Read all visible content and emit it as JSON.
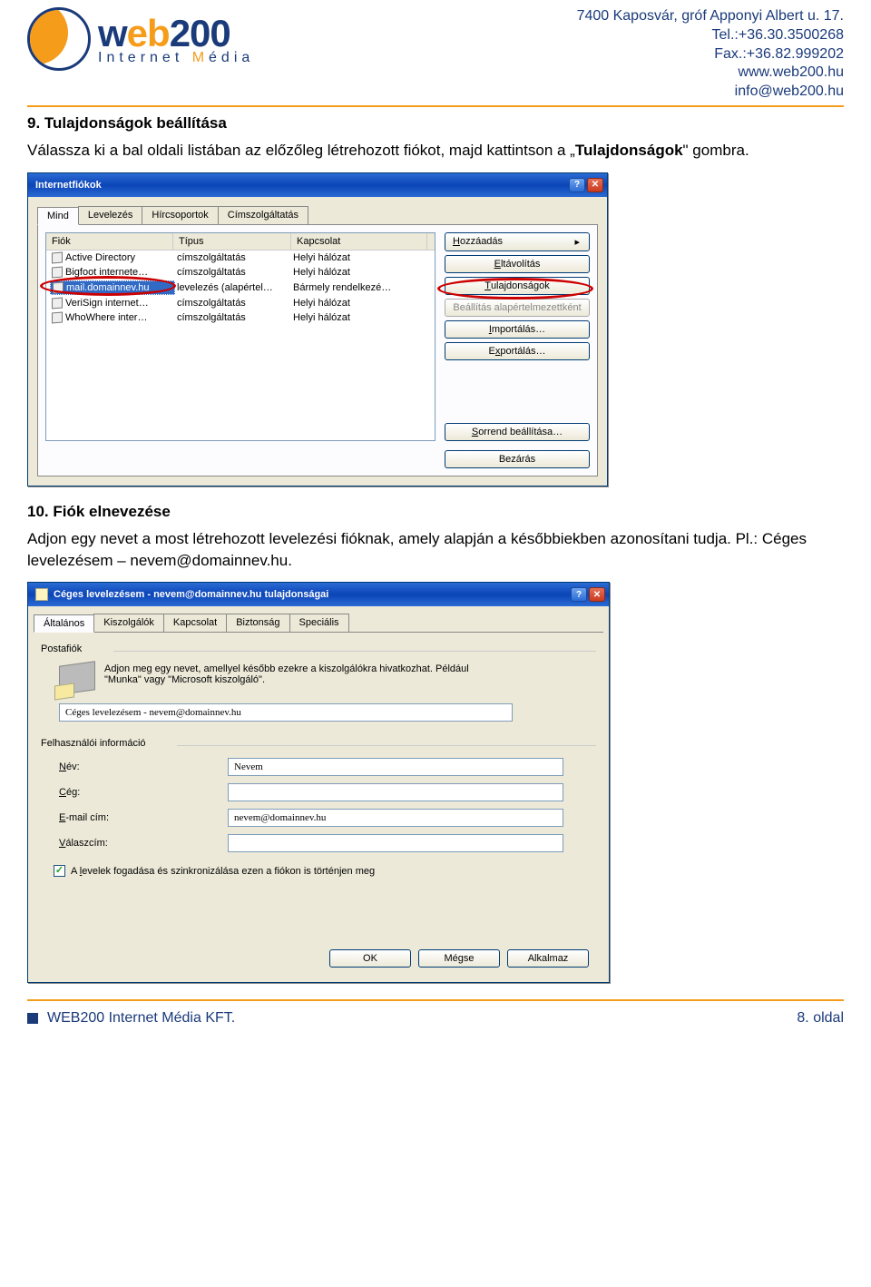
{
  "header": {
    "company_name": "web200",
    "subtitle": "Internet Média",
    "contact": {
      "address": "7400 Kaposvár, gróf Apponyi Albert u. 17.",
      "tel": "Tel.:+36.30.3500268",
      "fax": "Fax.:+36.82.999202",
      "web": "www.web200.hu",
      "email": "info@web200.hu"
    }
  },
  "section9": {
    "heading": "9.   Tulajdonságok beállítása",
    "text_pre": "Válassza ki a bal oldali listában az előzőleg létrehozott fiókot, majd kattintson a „",
    "text_bold": "Tulajdonságok",
    "text_post": "\" gombra."
  },
  "dialog1": {
    "title": "Internetfiókok",
    "tabs": [
      "Mind",
      "Levelezés",
      "Hírcsoportok",
      "Címszolgáltatás"
    ],
    "active_tab": 0,
    "columns": {
      "c1": "Fiók",
      "c2": "Típus",
      "c3": "Kapcsolat"
    },
    "rows": [
      {
        "c1": "Active Directory",
        "c2": "címszolgáltatás",
        "c3": "Helyi hálózat"
      },
      {
        "c1": "Bigfoot internete…",
        "c2": "címszolgáltatás",
        "c3": "Helyi hálózat"
      },
      {
        "c1": "mail.domainnev.hu",
        "c2": "levelezés (alapértel…",
        "c3": "Bármely rendelkezé…"
      },
      {
        "c1": "VeriSign internet…",
        "c2": "címszolgáltatás",
        "c3": "Helyi hálózat"
      },
      {
        "c1": "WhoWhere inter…",
        "c2": "címszolgáltatás",
        "c3": "Helyi hálózat"
      }
    ],
    "buttons": {
      "add": "Hozzáadás",
      "remove": "Eltávolítás",
      "props": "Tulajdonságok",
      "default": "Beállítás alapértelmezettként",
      "import": "Importálás…",
      "export": "Exportálás…",
      "order": "Sorrend beállítása…",
      "close": "Bezárás"
    }
  },
  "section10": {
    "heading": "10. Fiók elnevezése",
    "text": "Adjon egy nevet a most létrehozott levelezési fióknak, amely alapján a későbbiekben azonosítani tudja. Pl.: Céges levelezésem – nevem@domainnev.hu."
  },
  "dialog2": {
    "title": "Céges levelezésem - nevem@domainnev.hu tulajdonságai",
    "tabs": [
      "Általános",
      "Kiszolgálók",
      "Kapcsolat",
      "Biztonság",
      "Speciális"
    ],
    "active_tab": 0,
    "group_mailbox": "Postafiók",
    "hint": "Adjon meg egy nevet, amellyel később ezekre a kiszolgálókra hivatkozhat. Például \"Munka\" vagy \"Microsoft kiszolgáló\".",
    "account_name": "Céges levelezésem - nevem@domainnev.hu",
    "group_userinfo": "Felhasználói információ",
    "fields": {
      "name": {
        "label": "Név:",
        "value": "Nevem"
      },
      "company": {
        "label": "Cég:",
        "value": ""
      },
      "email": {
        "label": "E-mail cím:",
        "value": "nevem@domainnev.hu"
      },
      "reply": {
        "label": "Válaszcím:",
        "value": ""
      }
    },
    "checkbox_label": "A levelek fogadása és szinkronizálása ezen a fiókon is történjen meg",
    "buttons": {
      "ok": "OK",
      "cancel": "Mégse",
      "apply": "Alkalmaz"
    }
  },
  "footer": {
    "company": "WEB200 Internet Média KFT.",
    "page": "8. oldal"
  }
}
